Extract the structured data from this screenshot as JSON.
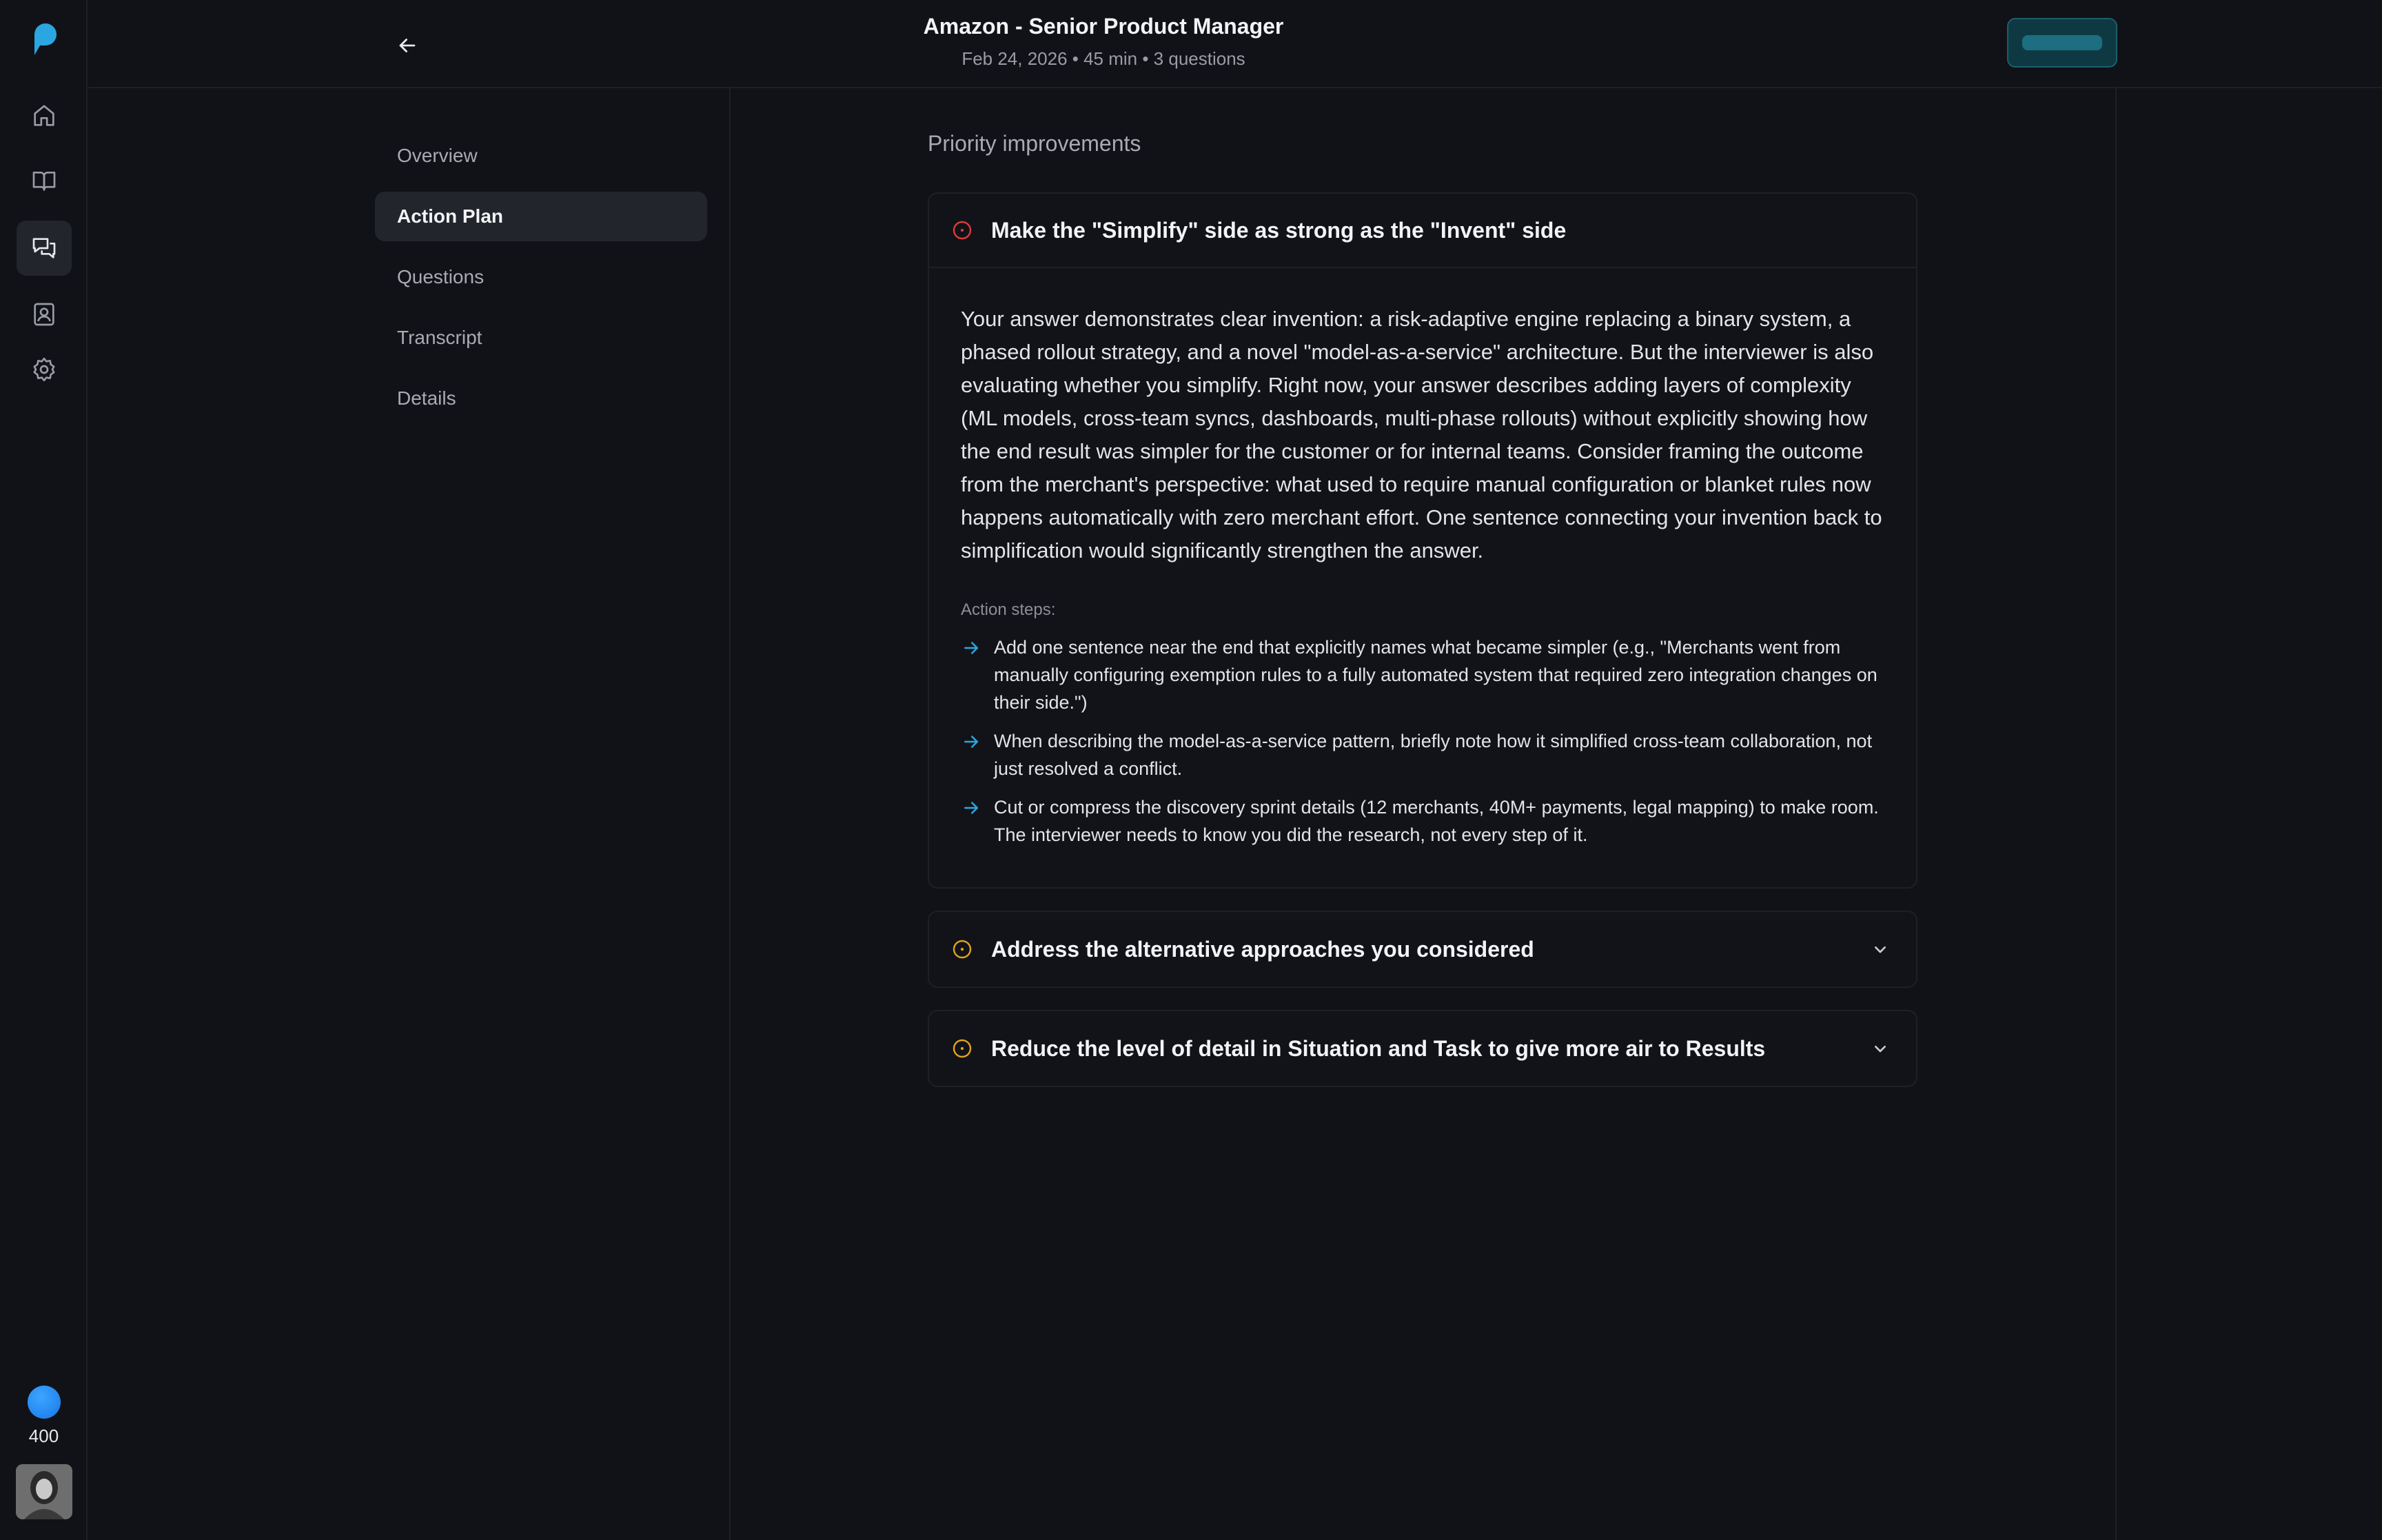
{
  "header": {
    "title": "Amazon - Senior Product Manager",
    "subtitle": "Feb 24, 2026 • 45 min • 3 questions"
  },
  "rail": {
    "credits": "400",
    "nav": [
      "home-icon",
      "book-icon",
      "chat-icon",
      "profile-card-icon",
      "gear-icon"
    ]
  },
  "sections": [
    {
      "label": "Overview"
    },
    {
      "label": "Action Plan"
    },
    {
      "label": "Questions"
    },
    {
      "label": "Transcript"
    },
    {
      "label": "Details"
    }
  ],
  "main": {
    "heading": "Priority improvements",
    "items": [
      {
        "title": "Make the \"Simplify\" side as strong as the \"Invent\" side",
        "severity_color": "#e03a3a",
        "expanded": true,
        "body": "Your answer demonstrates clear invention: a risk-adaptive engine replacing a binary system, a phased rollout strategy, and a novel \"model-as-a-service\" architecture. But the interviewer is also evaluating whether you simplify. Right now, your answer describes adding layers of complexity (ML models, cross-team syncs, dashboards, multi-phase rollouts) without explicitly showing how the end result was simpler for the customer or for internal teams. Consider framing the outcome from the merchant's perspective: what used to require manual configuration or blanket rules now happens automatically with zero merchant effort. One sentence connecting your invention back to simplification would significantly strengthen the answer.",
        "steps_label": "Action steps:",
        "steps": [
          "Add one sentence near the end that explicitly names what became simpler (e.g., \"Merchants went from manually configuring exemption rules to a fully automated system that required zero integration changes on their side.\")",
          "When describing the model-as-a-service pattern, briefly note how it simplified cross-team collaboration, not just resolved a conflict.",
          "Cut or compress the discovery sprint details (12 merchants, 40M+ payments, legal mapping) to make room. The interviewer needs to know you did the research, not every step of it."
        ]
      },
      {
        "title": "Address the alternative approaches you considered",
        "severity_color": "#e0a21e",
        "expanded": false
      },
      {
        "title": "Reduce the level of detail in Situation and Task to give more air to Results",
        "severity_color": "#e0a21e",
        "expanded": false
      }
    ]
  },
  "colors": {
    "accent": "#2aa7e0",
    "background": "#111217"
  }
}
